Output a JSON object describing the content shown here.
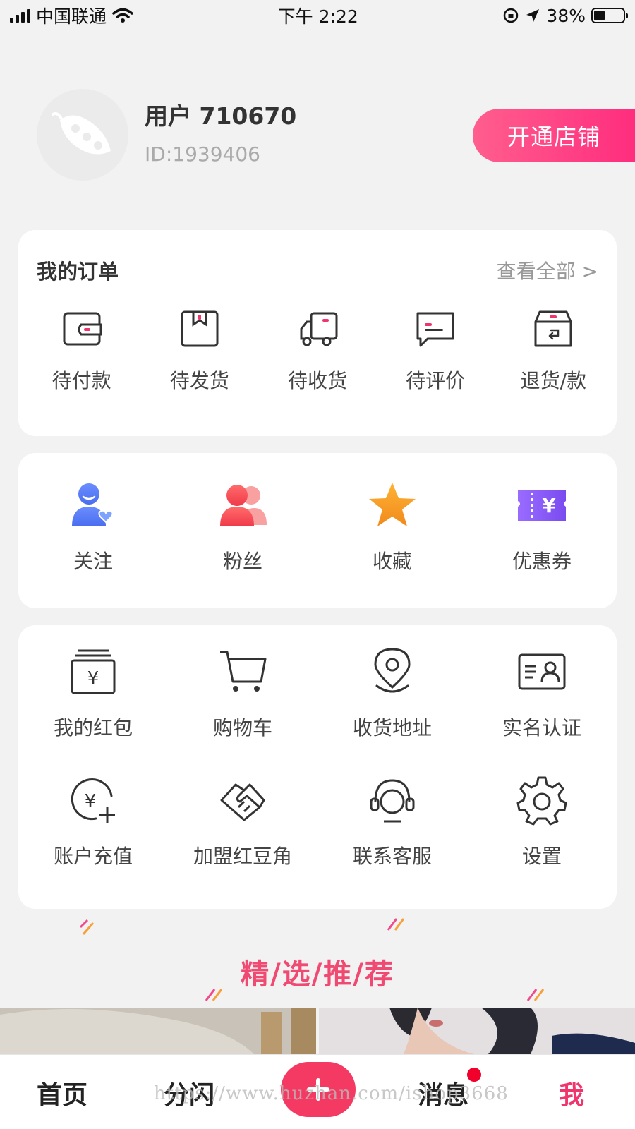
{
  "status_bar": {
    "carrier": "中国联通",
    "time": "下午 2:22",
    "battery": "38%",
    "battery_level": 0.38
  },
  "profile": {
    "username": "用户 710670",
    "user_id": "ID:1939406",
    "open_shop_label": "开通店铺"
  },
  "orders": {
    "title": "我的订单",
    "view_all": "查看全部 >",
    "items": [
      {
        "label": "待付款",
        "icon": "wallet-icon"
      },
      {
        "label": "待发货",
        "icon": "package-icon"
      },
      {
        "label": "待收货",
        "icon": "truck-icon"
      },
      {
        "label": "待评价",
        "icon": "comment-icon"
      },
      {
        "label": "退货/款",
        "icon": "return-box-icon"
      }
    ]
  },
  "social": {
    "items": [
      {
        "label": "关注",
        "icon": "follow-user-icon"
      },
      {
        "label": "粉丝",
        "icon": "fans-icon"
      },
      {
        "label": "收藏",
        "icon": "star-icon"
      },
      {
        "label": "优惠券",
        "icon": "coupon-icon"
      }
    ]
  },
  "tools": {
    "items": [
      {
        "label": "我的红包",
        "icon": "red-packet-icon"
      },
      {
        "label": "购物车",
        "icon": "cart-icon"
      },
      {
        "label": "收货地址",
        "icon": "location-icon"
      },
      {
        "label": "实名认证",
        "icon": "id-card-icon"
      },
      {
        "label": "账户充值",
        "icon": "recharge-icon"
      },
      {
        "label": "加盟红豆角",
        "icon": "handshake-icon"
      },
      {
        "label": "联系客服",
        "icon": "headset-icon"
      },
      {
        "label": "设置",
        "icon": "gear-icon"
      }
    ]
  },
  "recommend": {
    "title": "精/选/推/荐"
  },
  "tabbar": {
    "home": "首页",
    "flash": "分闪",
    "messages": "消息",
    "me": "我",
    "watermark": "https://www.huzhan.com/ishop3668"
  },
  "colors": {
    "accent": "#f0346c",
    "shop_button": "#ff3d84",
    "recommend_title": "#f14a72",
    "plus_button": "#f43a62"
  }
}
